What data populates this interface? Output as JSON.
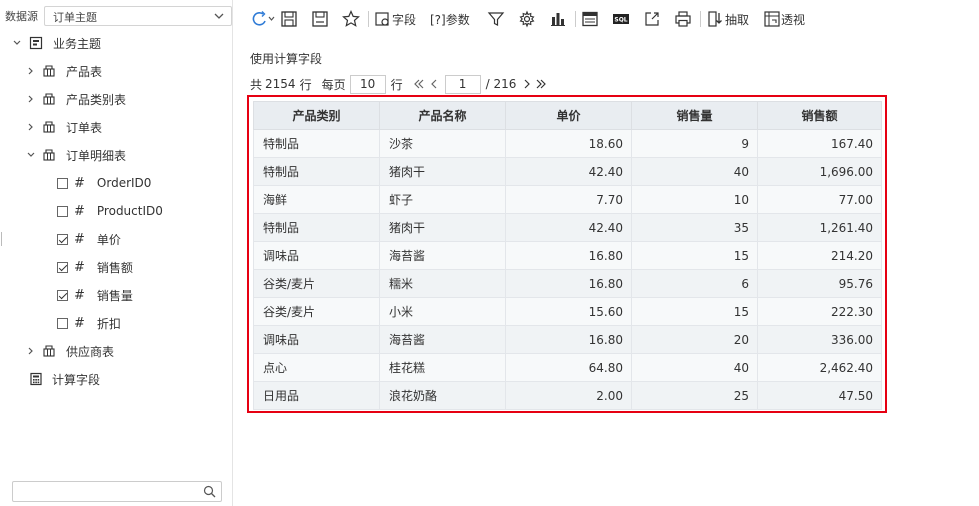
{
  "sidebar": {
    "datasource_label": "数据源",
    "datasource_value": "订单主题",
    "root": "业务主题",
    "tables": [
      "产品表",
      "产品类别表",
      "订单表",
      "订单明细表"
    ],
    "fields": [
      {
        "name": "OrderID0",
        "checked": false
      },
      {
        "name": "ProductID0",
        "checked": false
      },
      {
        "name": "单价",
        "checked": true
      },
      {
        "name": "销售额",
        "checked": true
      },
      {
        "name": "销售量",
        "checked": true
      },
      {
        "name": "折扣",
        "checked": false
      }
    ],
    "supplier": "供应商表",
    "calc_field": "计算字段",
    "search_placeholder": ""
  },
  "toolbar": {
    "field_label": "字段",
    "param_label": "[?]参数",
    "extract_label": "抽取",
    "pivot_label": "透视",
    "sql_label": "SQL"
  },
  "content": {
    "title": "使用计算字段",
    "pager": {
      "total_prefix": "共",
      "total": "2154",
      "row_unit": "行",
      "per_page_label": "每页",
      "per_page": "10",
      "row_unit2": "行",
      "current_page": "1",
      "total_pages": "/ 216"
    }
  },
  "table": {
    "headers": [
      "产品类别",
      "产品名称",
      "单价",
      "销售量",
      "销售额"
    ],
    "rows": [
      [
        "特制品",
        "沙茶",
        "18.60",
        "9",
        "167.40"
      ],
      [
        "特制品",
        "猪肉干",
        "42.40",
        "40",
        "1,696.00"
      ],
      [
        "海鲜",
        "虾子",
        "7.70",
        "10",
        "77.00"
      ],
      [
        "特制品",
        "猪肉干",
        "42.40",
        "35",
        "1,261.40"
      ],
      [
        "调味品",
        "海苔酱",
        "16.80",
        "15",
        "214.20"
      ],
      [
        "谷类/麦片",
        "糯米",
        "16.80",
        "6",
        "95.76"
      ],
      [
        "谷类/麦片",
        "小米",
        "15.60",
        "15",
        "222.30"
      ],
      [
        "调味品",
        "海苔酱",
        "16.80",
        "20",
        "336.00"
      ],
      [
        "点心",
        "桂花糕",
        "64.80",
        "40",
        "2,462.40"
      ],
      [
        "日用品",
        "浪花奶酪",
        "2.00",
        "25",
        "47.50"
      ]
    ]
  },
  "colors": {
    "highlight_border": "#e60012",
    "header_bg": "#e9edf1",
    "accent_blue": "#2f7bd6"
  }
}
